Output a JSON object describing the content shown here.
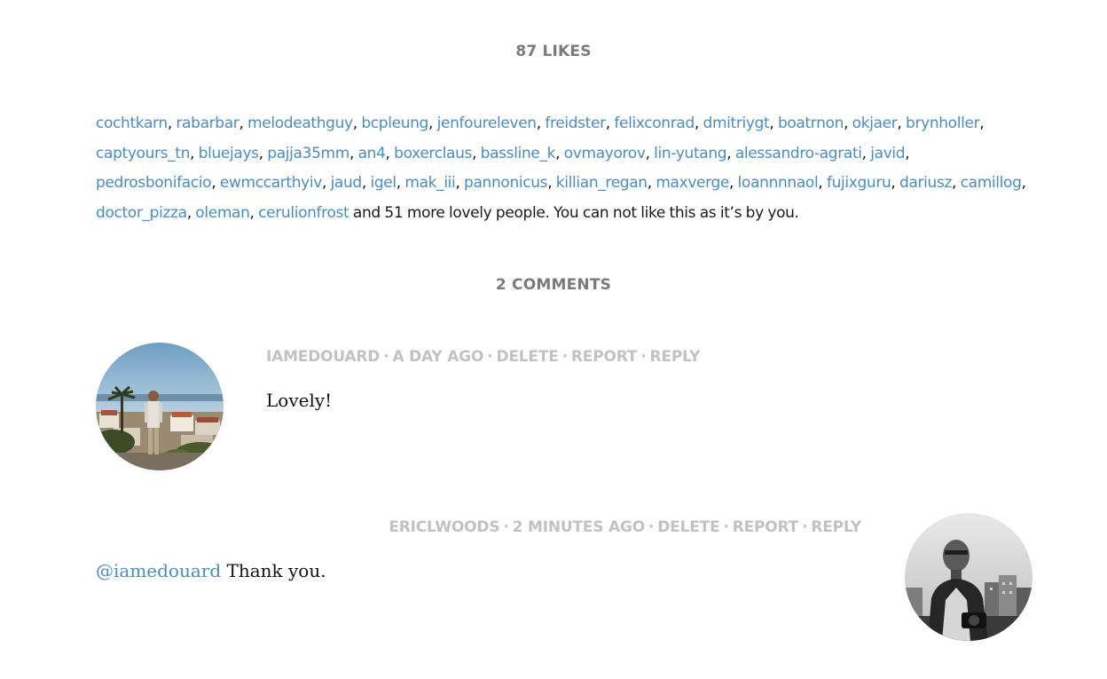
{
  "likes": {
    "title": "87 LIKES",
    "users": [
      "cochtkarn",
      "rabarbar",
      "melodeathguy",
      "bcpleung",
      "jenfoureleven",
      "freidster",
      "felixconrad",
      "dmitriygt",
      "boatrnon",
      "okjaer",
      "brynholler",
      "captyours_tn",
      "bluejays",
      "pajja35mm",
      "an4",
      "boxerclaus",
      "bassline_k",
      "ovmayorov",
      "lin-yutang",
      "alessandro-agrati",
      "javid",
      "pedrosbonifacio",
      "ewmccarthyiv",
      "jaud",
      "igel",
      "mak_iii",
      "pannonicus",
      "killian_regan",
      "maxverge",
      "loannnnaol",
      "fujixguru",
      "dariusz",
      "camillog",
      "doctor_pizza",
      "oleman",
      "cerulionfrost"
    ],
    "more_text": " and 51 more lovely people. You can not like this as it’s by you."
  },
  "comments": {
    "title": "2 COMMENTS",
    "items": [
      {
        "author": "IAMEDOUARD",
        "time": "A DAY AGO",
        "delete_label": "DELETE",
        "report_label": "REPORT",
        "reply_label": "REPLY",
        "mention": "",
        "text": "Lovely!"
      },
      {
        "author": "ERICLWOODS",
        "time": "2 MINUTES AGO",
        "delete_label": "DELETE",
        "report_label": "REPORT",
        "reply_label": "REPLY",
        "mention": "@iamedouard",
        "text": " Thank you."
      }
    ]
  },
  "colors": {
    "link": "#4a8cc6",
    "heading": "#7a7a7a",
    "meta": "#c2c2c2",
    "text": "#111111"
  }
}
